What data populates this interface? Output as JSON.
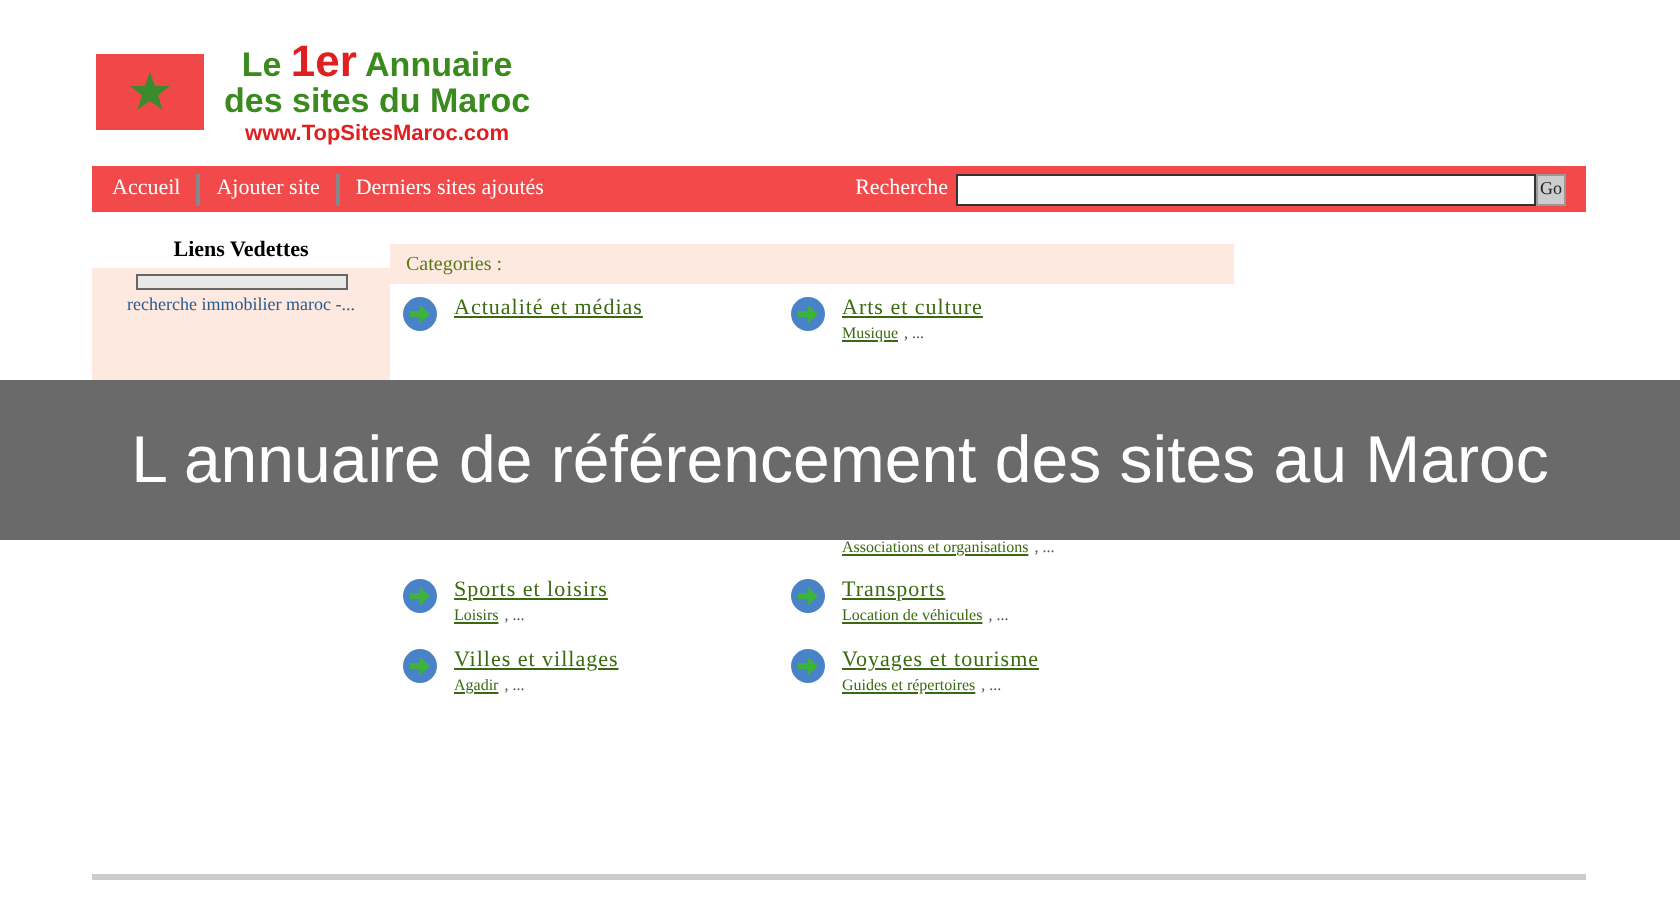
{
  "logo": {
    "line_1": "Le **1er** Annuaire",
    "line_2": "des sites du Maroc",
    "url": "www.TopSitesMaroc.com"
  },
  "nav": {
    "items": [
      "Accueil",
      "Ajouter site",
      "Derniers sites ajoutés"
    ],
    "search_label": "Recherche",
    "search_button": "Go"
  },
  "sidebar": {
    "title": "Liens Vedettes",
    "links": [
      "recherche immobilier maroc -..."
    ]
  },
  "categories": {
    "title": "Categories :",
    "rows": [
      {
        "left": {
          "name": "Actualité et médias"
        },
        "right": {
          "name": "Arts et culture",
          "subs": [
            "Musique"
          ],
          "more": ", ..."
        }
      },
      {
        "right": {
          "subs": [
            "Associations et organisations"
          ],
          "more": ", ..."
        }
      },
      {
        "left": {
          "name": "Sports et loisirs",
          "subs": [
            "Loisirs"
          ],
          "more": ", ..."
        },
        "right": {
          "name": "Transports",
          "subs": [
            "Location de véhicules"
          ],
          "more": ", ..."
        }
      },
      {
        "left": {
          "name": "Villes et villages",
          "subs": [
            "Agadir"
          ],
          "more": ", ..."
        },
        "right": {
          "name": "Voyages et tourisme",
          "subs": [
            "Guides et répertoires"
          ],
          "more": ", ..."
        }
      }
    ]
  },
  "caption": "L annuaire de référencement des sites au Maroc"
}
